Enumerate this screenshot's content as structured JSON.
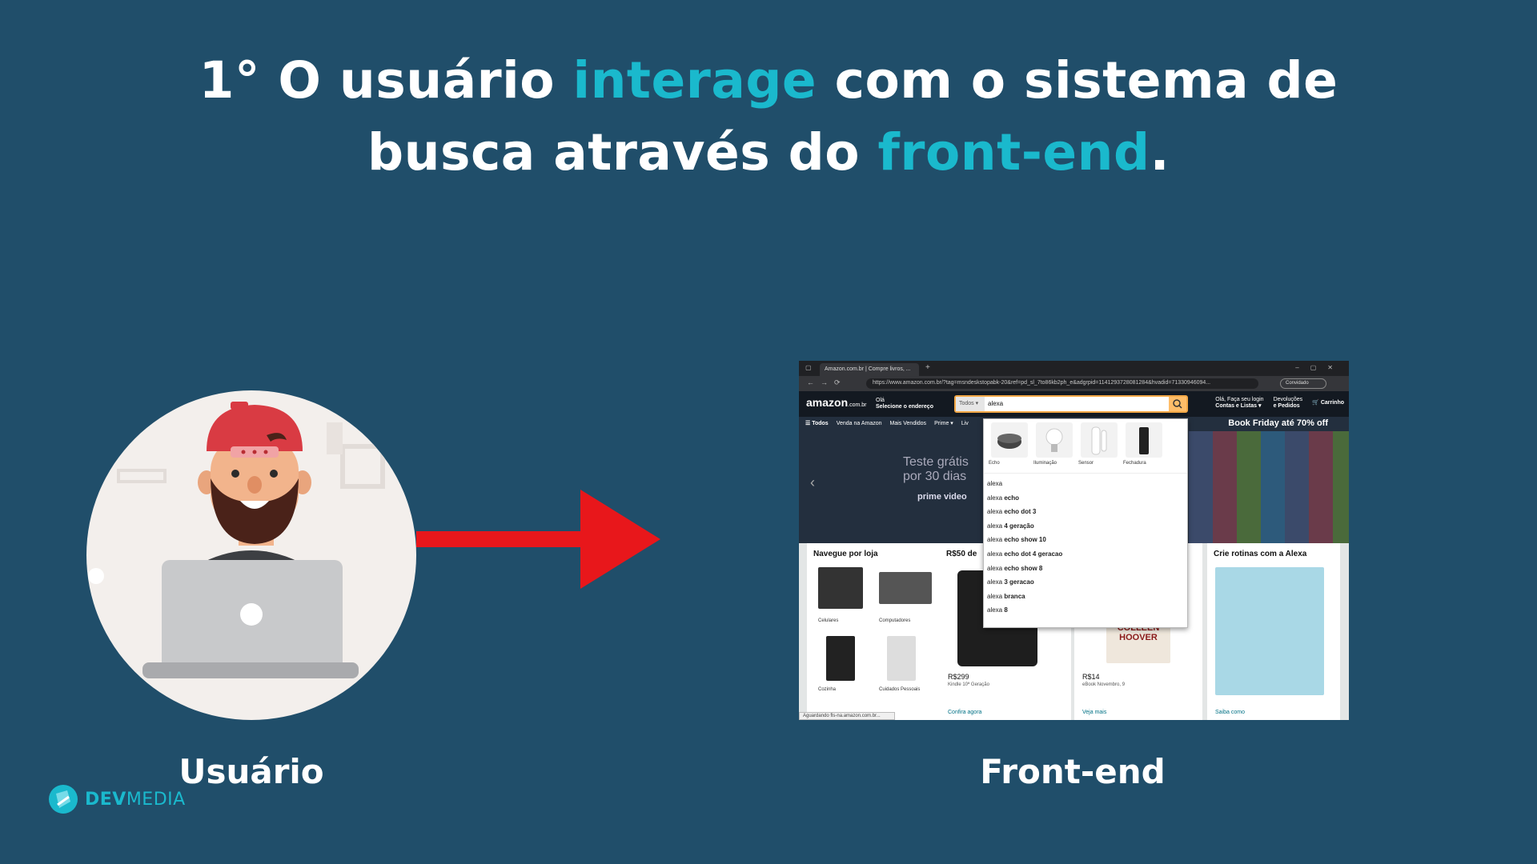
{
  "headline": {
    "line1_part1": "1° O usuário ",
    "line1_highlight": "interage",
    "line1_part2": " com o sistema de",
    "line2_part1": "busca através do ",
    "line2_highlight": "front-end",
    "line2_part2": "."
  },
  "left_caption": "Usuário",
  "right_caption": "Front-end",
  "logo": {
    "dev": "DEV",
    "media": "MEDIA"
  },
  "colors": {
    "background": "#204e6a",
    "highlight": "#1ab9cd",
    "arrow": "#e8171b"
  },
  "browser": {
    "tab_title": "Amazon.com.br | Compre livros, ...",
    "url": "https://www.amazon.com.br/?tag=msndeskstopabk-20&ref=pd_sl_7to86kb2ph_e&adgrpid=1141293728081284&hvadid=71330946094...",
    "guest_label": "Convidado",
    "amazon": {
      "logo": "amazon",
      "logo_suffix": ".com.br",
      "addr_line1": "Olá",
      "addr_line2": "Selecione o endereço",
      "search_category": "Todos ▾",
      "search_query": "alexa",
      "account_line1": "Olá, Faça seu login",
      "account_line2": "Contas e Listas ▾",
      "orders_line1": "Devoluções",
      "orders_line2": "e Pedidos",
      "cart_label": "Carrinho",
      "subnav": [
        "☰ Todos",
        "Venda na Amazon",
        "Mais Vendidos",
        "Prime ▾",
        "Liv"
      ],
      "promo": "Book Friday até 70% off",
      "hero_text_line1": "Teste grátis",
      "hero_text_line2": "por 30 dias",
      "hero_brand": "prime video",
      "card1_title": "Navegue por loja",
      "card1_items": [
        "Celulares",
        "Computadores",
        "Cozinha",
        "Cuidados Pessoais"
      ],
      "card1_link": "",
      "card2_title": "R$50 de",
      "card2_price": "R$299",
      "card2_desc": "Kindle 10ª Geração",
      "card2_link": "Confira agora",
      "card3_price": "R$14",
      "card3_desc": "eBook Novembro, 9",
      "card3_book": "COLLEEN HOOVER",
      "card3_link": "Veja mais",
      "card4_title": "Crie rotinas com a Alexa",
      "card4_link": "Saiba como",
      "status": "Aguardando fls-na.amazon.com.br..."
    },
    "suggestions": {
      "products": [
        "Echo",
        "Iluminação",
        "Sensor",
        "Fechadura"
      ],
      "items": [
        {
          "prefix": "alexa",
          "suffix": ""
        },
        {
          "prefix": "alexa ",
          "suffix": "echo"
        },
        {
          "prefix": "alexa ",
          "suffix": "echo dot 3"
        },
        {
          "prefix": "alexa ",
          "suffix": "4 geração"
        },
        {
          "prefix": "alexa ",
          "suffix": "echo show 10"
        },
        {
          "prefix": "alexa ",
          "suffix": "echo dot 4 geracao"
        },
        {
          "prefix": "alexa ",
          "suffix": "echo show 8"
        },
        {
          "prefix": "alexa ",
          "suffix": "3 geracao"
        },
        {
          "prefix": "alexa ",
          "suffix": "branca"
        },
        {
          "prefix": "alexa ",
          "suffix": "8"
        }
      ]
    }
  }
}
